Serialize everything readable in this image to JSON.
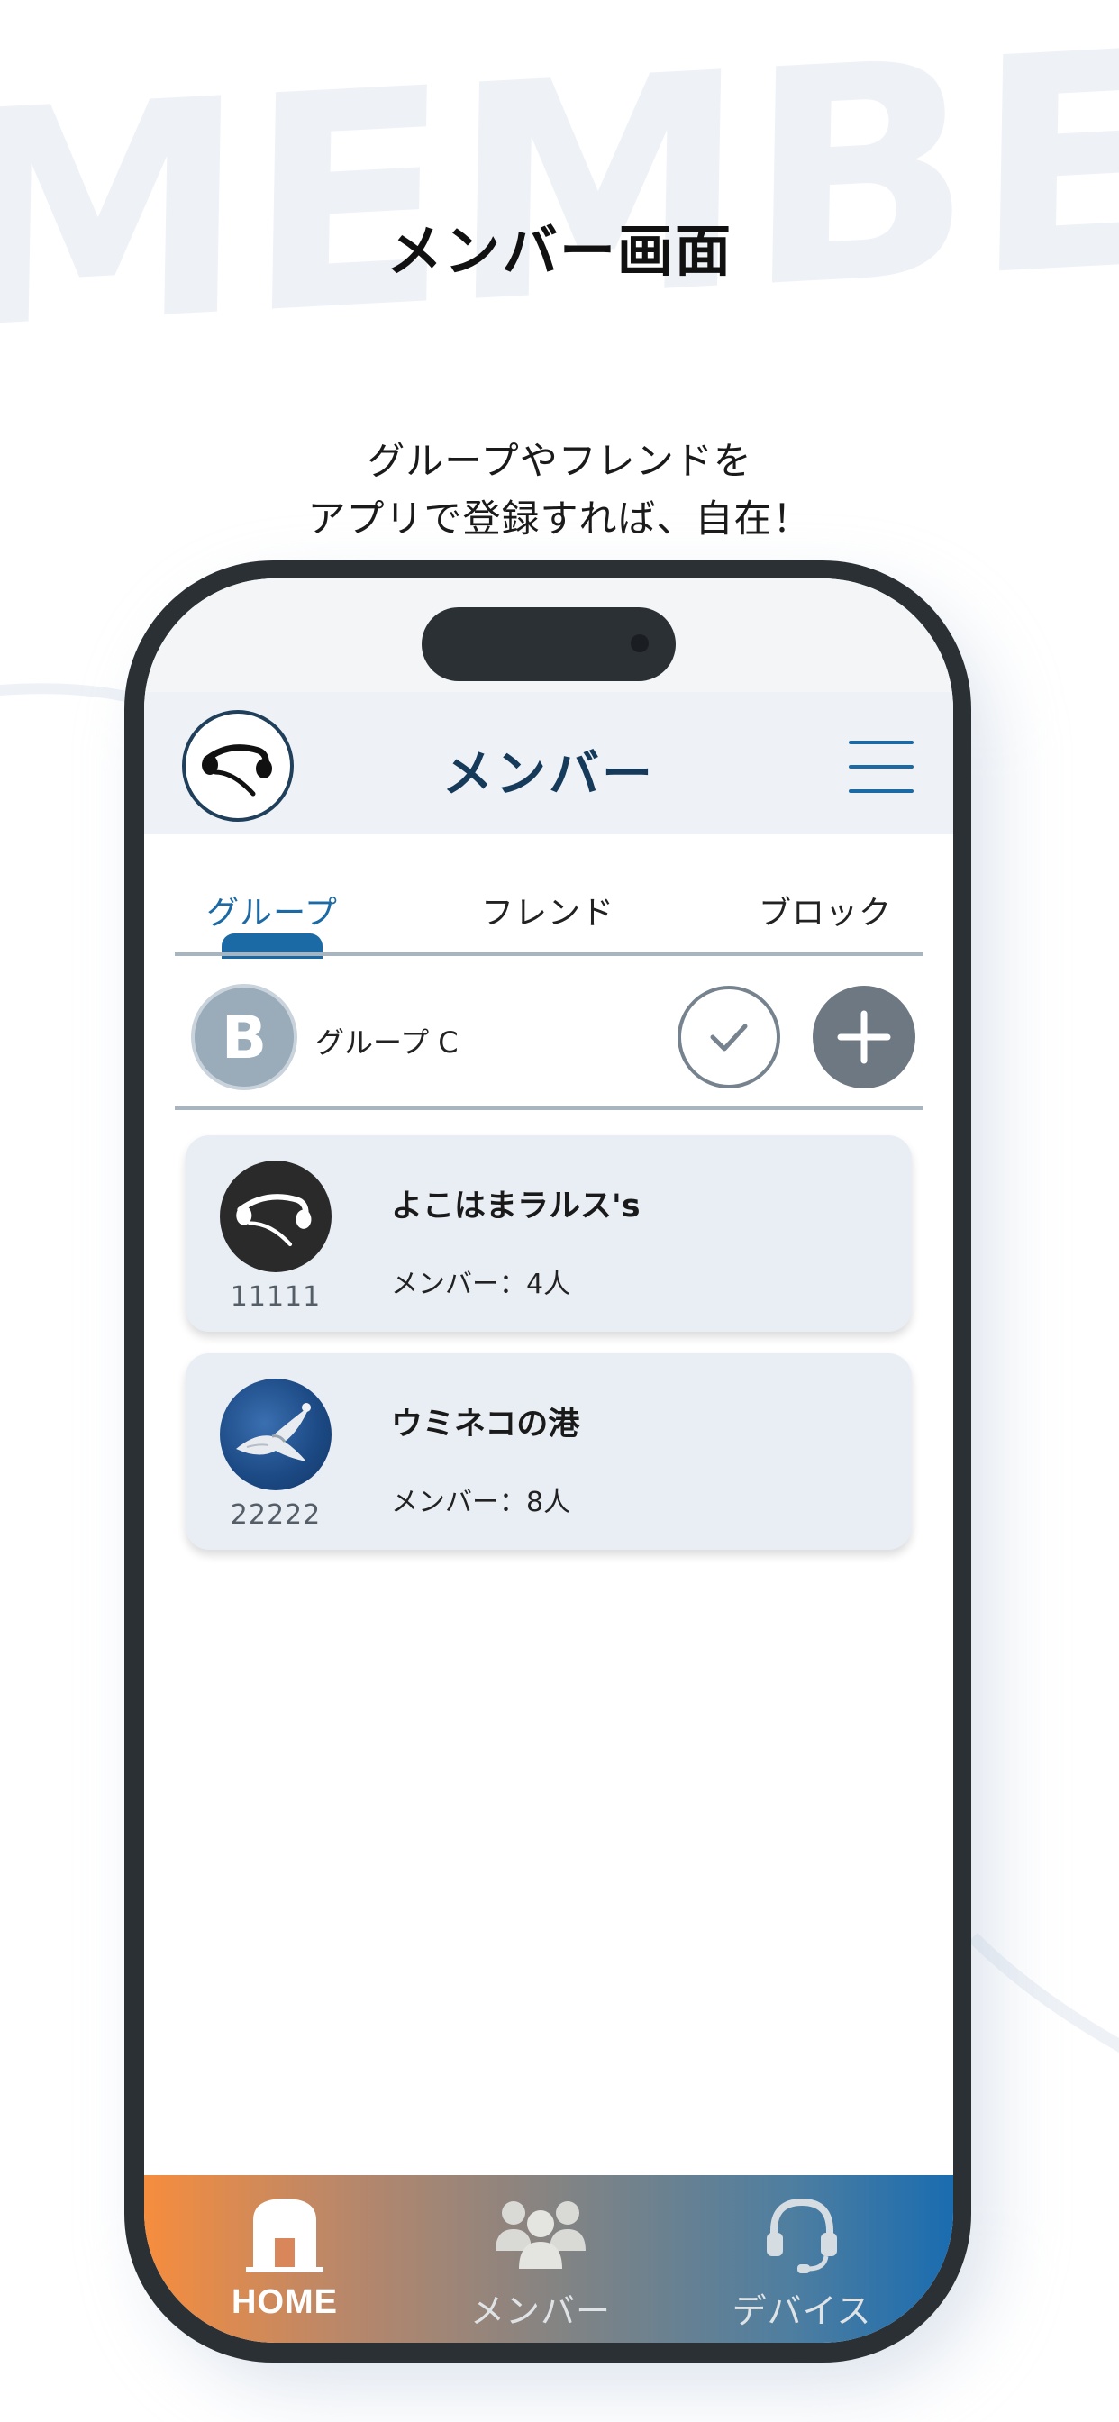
{
  "background": {
    "watermark_text": "MEMBER"
  },
  "hero": {
    "headline": "メンバー画面",
    "subtitle_line1": "グループやフレンドを",
    "subtitle_line2": "アプリで登録すれば、自在！"
  },
  "app": {
    "title": "メンバー",
    "tabs": [
      {
        "label": "グループ",
        "active": true
      },
      {
        "label": "フレンド",
        "active": false
      },
      {
        "label": "ブロック",
        "active": false
      }
    ],
    "selected_group": {
      "avatar_letter": "B",
      "name": "グループ C"
    },
    "groups": [
      {
        "name": "よこはまラルス's",
        "member_count": "メンバー：4人",
        "id": "11111",
        "avatar": "headphone-logo"
      },
      {
        "name": "ウミネコの港",
        "member_count": "メンバー：8人",
        "id": "22222",
        "avatar": "seagull-photo"
      }
    ],
    "bottom_nav": [
      {
        "label": "HOME",
        "icon": "home-icon",
        "active": true
      },
      {
        "label": "メンバー",
        "icon": "members-icon",
        "active": false
      },
      {
        "label": "デバイス",
        "icon": "headset-icon",
        "active": false
      }
    ]
  },
  "colors": {
    "accent": "#1b6aa5",
    "title": "#163a5a",
    "nav_gradient_start": "#f68d3e",
    "nav_gradient_end": "#1a6cb0"
  }
}
